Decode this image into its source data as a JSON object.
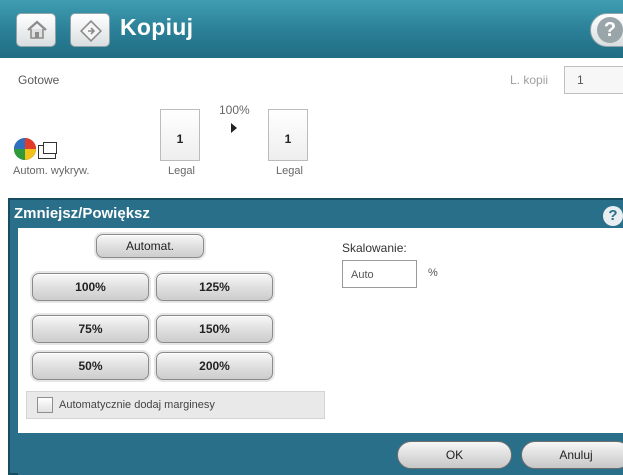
{
  "header": {
    "title": "Kopiuj",
    "icons": [
      "home-icon",
      "copy-app-icon",
      "help-icon"
    ],
    "color": "#2a7f96"
  },
  "status": {
    "text": "Gotowe",
    "copies_label": "L. kopii",
    "copies_value": "1"
  },
  "preview": {
    "zoom": "100%",
    "color_mode": "Autom. wykryw.",
    "original": {
      "number": "1",
      "label": "Legal"
    },
    "output": {
      "number": "1",
      "label": "Legal"
    }
  },
  "dialog": {
    "title": "Zmniejsz/Powiększ",
    "help": "?",
    "auto_label": "Automat.",
    "scale_buttons": {
      "b100": "100%",
      "b125": "125%",
      "b75": "75%",
      "b150": "150%",
      "b50": "50%",
      "b200": "200%"
    },
    "checkbox_label": "Automatycznie dodaj marginesy",
    "checkbox_checked": false,
    "scaling_label": "Skalowanie:",
    "scaling_value": "Auto",
    "percent_sign": "%",
    "ok_label": "OK",
    "cancel_label": "Anuluj",
    "color": "#2a6f8a"
  }
}
